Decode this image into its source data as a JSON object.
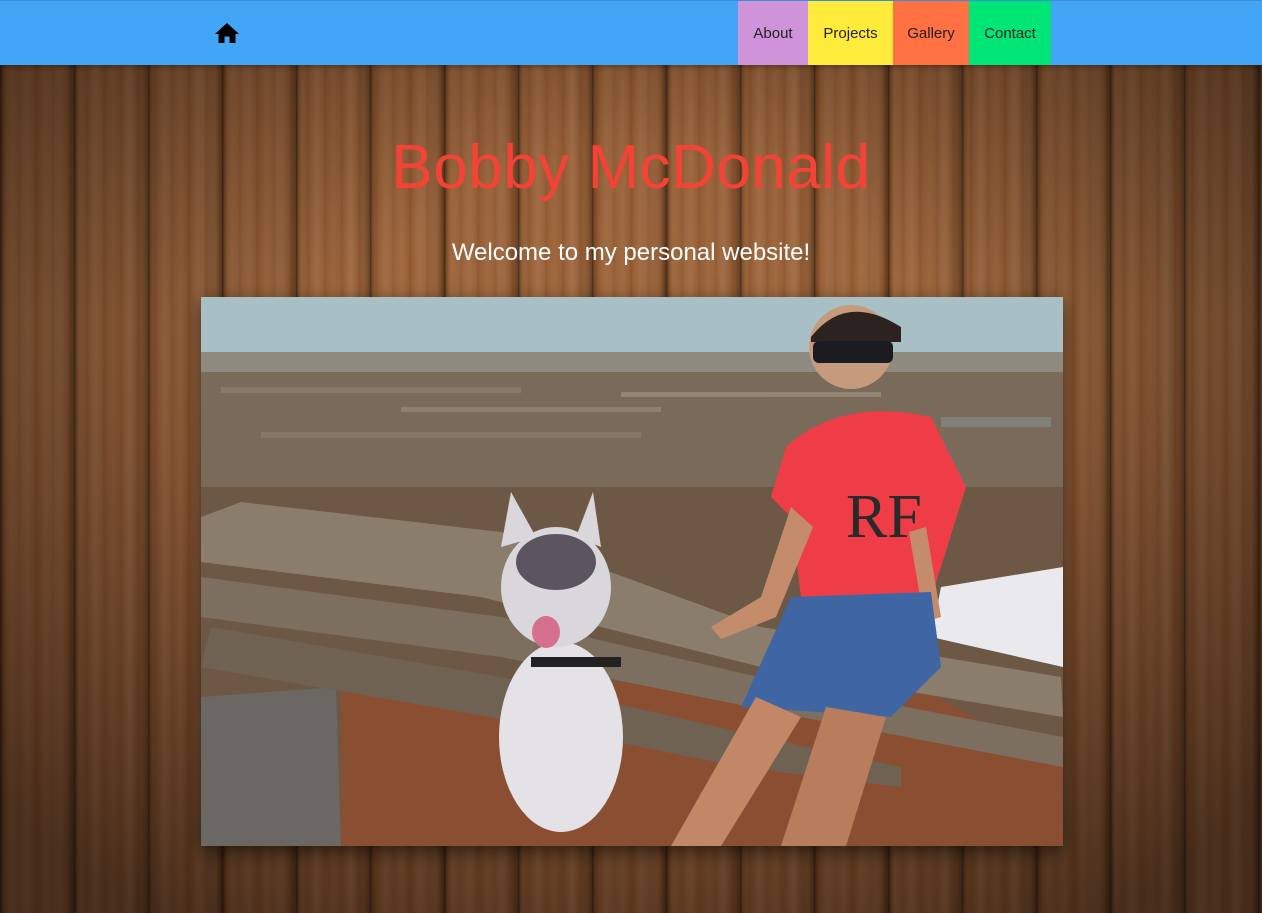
{
  "navbar": {
    "home_icon": "home-icon",
    "items": [
      {
        "label": "About",
        "color": "#ce93d8"
      },
      {
        "label": "Projects",
        "color": "#ffeb3b"
      },
      {
        "label": "Gallery",
        "color": "#ff7043"
      },
      {
        "label": "Contact",
        "color": "#00e676"
      }
    ],
    "background": "#42a5f5"
  },
  "hero": {
    "title": "Bobby McDonald",
    "title_color": "#f44336",
    "subtitle": "Welcome to my personal website!"
  },
  "photo": {
    "shirt_logo": "RF"
  }
}
